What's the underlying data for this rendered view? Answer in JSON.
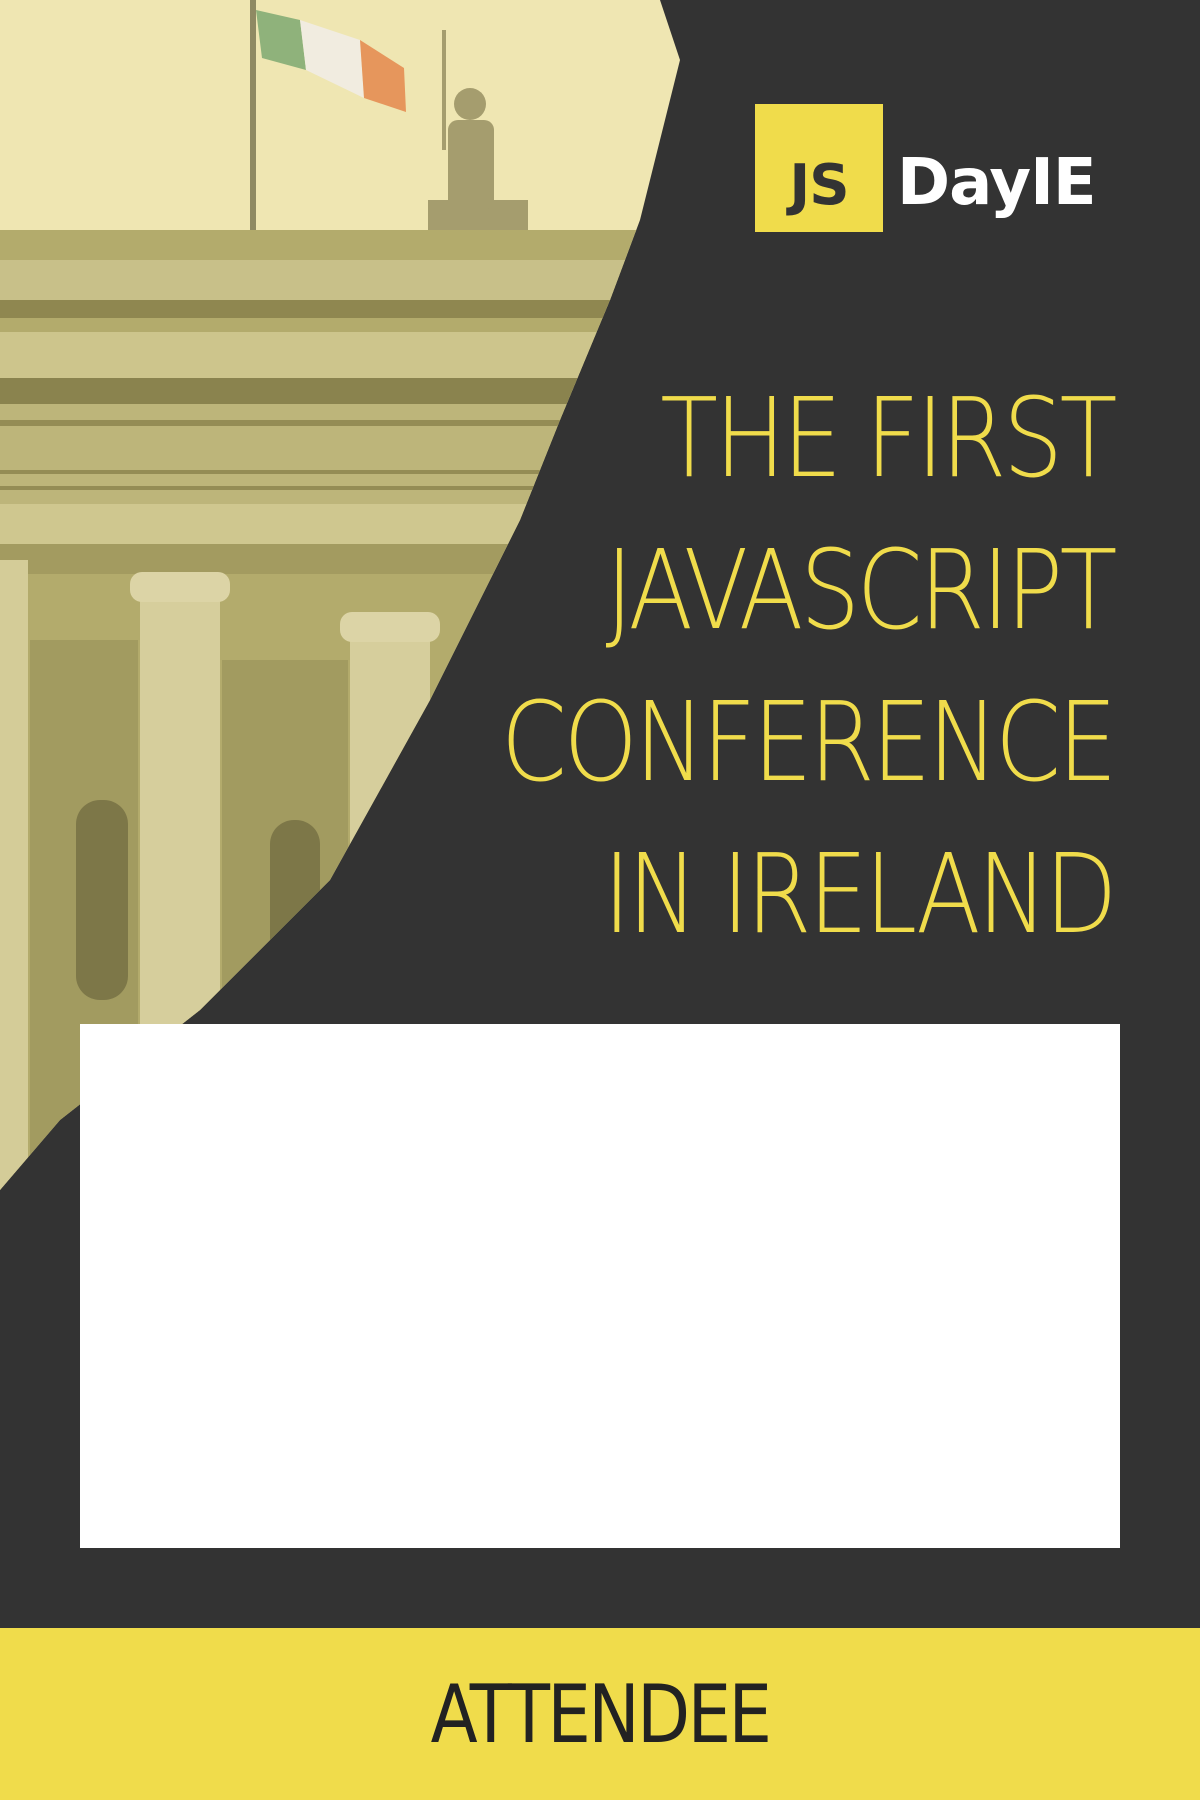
{
  "logo": {
    "mark": "JS",
    "name": "DayIE"
  },
  "headline": {
    "lines": [
      "THE FIRST",
      "JAVASCRIPT",
      "CONFERENCE",
      "IN IRELAND"
    ]
  },
  "name_box": {
    "text": ""
  },
  "role": {
    "label": "ATTENDEE"
  },
  "colors": {
    "background": "#333333",
    "accent": "#f0dc4b",
    "name_box": "#ffffff",
    "role_text": "#222222"
  },
  "images": {
    "photo": "gpo-dublin-building-with-irish-flag"
  }
}
